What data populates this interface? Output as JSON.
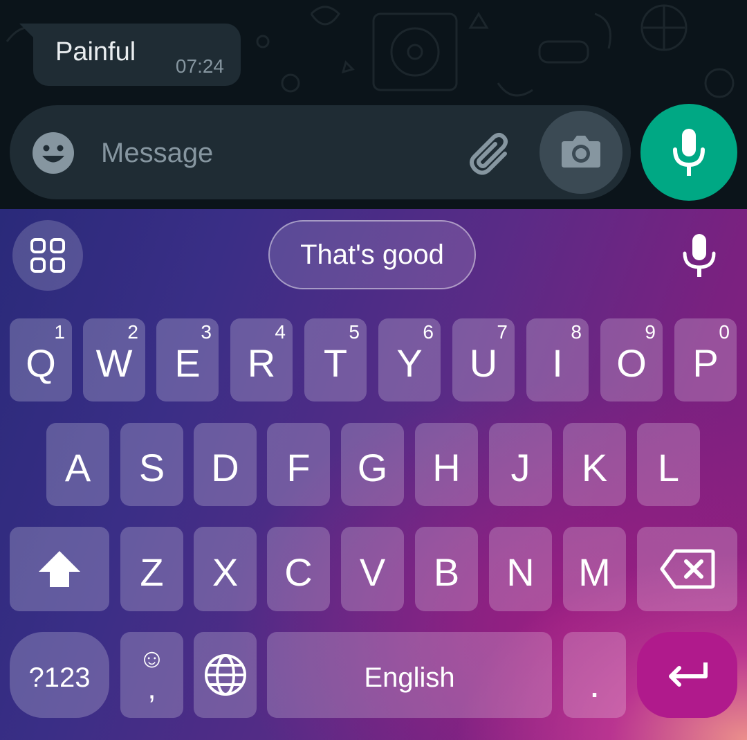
{
  "chat": {
    "message": {
      "text": "Painful",
      "time": "07:24"
    },
    "composer": {
      "placeholder": "Message"
    }
  },
  "icons": {
    "emoji": "smiley-face-icon",
    "attach": "paperclip-icon",
    "camera": "camera-icon",
    "mic": "microphone-icon",
    "apps": "grid-icon",
    "voice": "microphone-icon",
    "shift": "shift-arrow-icon",
    "backspace": "backspace-icon",
    "globe": "globe-icon",
    "enter": "enter-arrow-icon"
  },
  "colors": {
    "mic_button": "#00a884",
    "bubble": "#1f2c34",
    "enter_key": "#b01a8c"
  },
  "keyboard": {
    "suggestion": "That's good",
    "row1": [
      {
        "label": "Q",
        "hint": "1"
      },
      {
        "label": "W",
        "hint": "2"
      },
      {
        "label": "E",
        "hint": "3"
      },
      {
        "label": "R",
        "hint": "4"
      },
      {
        "label": "T",
        "hint": "5"
      },
      {
        "label": "Y",
        "hint": "6"
      },
      {
        "label": "U",
        "hint": "7"
      },
      {
        "label": "I",
        "hint": "8"
      },
      {
        "label": "O",
        "hint": "9"
      },
      {
        "label": "P",
        "hint": "0"
      }
    ],
    "row2": [
      {
        "label": "A"
      },
      {
        "label": "S"
      },
      {
        "label": "D"
      },
      {
        "label": "F"
      },
      {
        "label": "G"
      },
      {
        "label": "H"
      },
      {
        "label": "J"
      },
      {
        "label": "K"
      },
      {
        "label": "L"
      }
    ],
    "row3": [
      {
        "label": "Z"
      },
      {
        "label": "X"
      },
      {
        "label": "C"
      },
      {
        "label": "V"
      },
      {
        "label": "B"
      },
      {
        "label": "N"
      },
      {
        "label": "M"
      }
    ],
    "symbols_key": "?123",
    "comma_key": ",",
    "comma_emoji": "☺",
    "space_key": "English",
    "period_key": "."
  }
}
